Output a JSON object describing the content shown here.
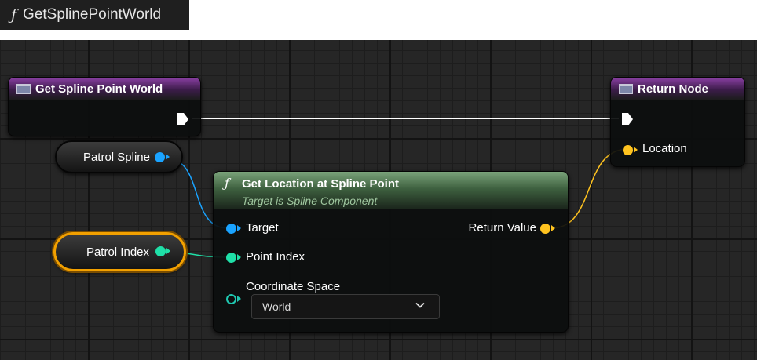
{
  "tab": {
    "icon": "function-icon",
    "glyph": "ƒ",
    "title": "GetSplinePointWorld"
  },
  "entry_node": {
    "title": "Get Spline Point World",
    "icon": "function-entry-icon"
  },
  "return_node": {
    "title": "Return Node",
    "icon": "function-entry-icon",
    "output_label": "Location"
  },
  "var_patrol_spline": {
    "label": "Patrol Spline"
  },
  "var_patrol_index": {
    "label": "Patrol Index"
  },
  "call_node": {
    "glyph": "ƒ",
    "title": "Get Location at Spline Point",
    "subtitle": "Target is Spline Component",
    "inputs": [
      "Target",
      "Point Index",
      "Coordinate Space"
    ],
    "output": "Return Value",
    "coordinate_space_value": "World"
  },
  "colors": {
    "object_pin": "#1aa3ff",
    "int_pin": "#1fe0a8",
    "vector_pin": "#ffc31f",
    "exec_wire": "#ffffff",
    "selected_outline": "#f2a000"
  }
}
